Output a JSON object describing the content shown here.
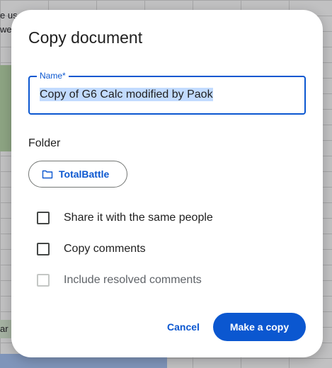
{
  "background": {
    "text_fragments": [
      "e us",
      "we",
      "ar"
    ]
  },
  "dialog": {
    "title": "Copy document",
    "name_field": {
      "label": "Name*",
      "value": "Copy of G6 Calc modified by Paok",
      "text_selected": true
    },
    "folder": {
      "heading": "Folder",
      "chip_label": "TotalBattle",
      "icon": "folder-icon"
    },
    "options": [
      {
        "label": "Share it with the same people",
        "checked": false,
        "disabled": false
      },
      {
        "label": "Copy comments",
        "checked": false,
        "disabled": false
      },
      {
        "label": "Include resolved comments",
        "checked": false,
        "disabled": true
      }
    ],
    "actions": {
      "cancel_label": "Cancel",
      "confirm_label": "Make a copy"
    }
  },
  "colors": {
    "accent": "#0b57d0",
    "selection": "#c2dbff",
    "scrim": "rgba(32, 33, 36, 0.28)"
  }
}
